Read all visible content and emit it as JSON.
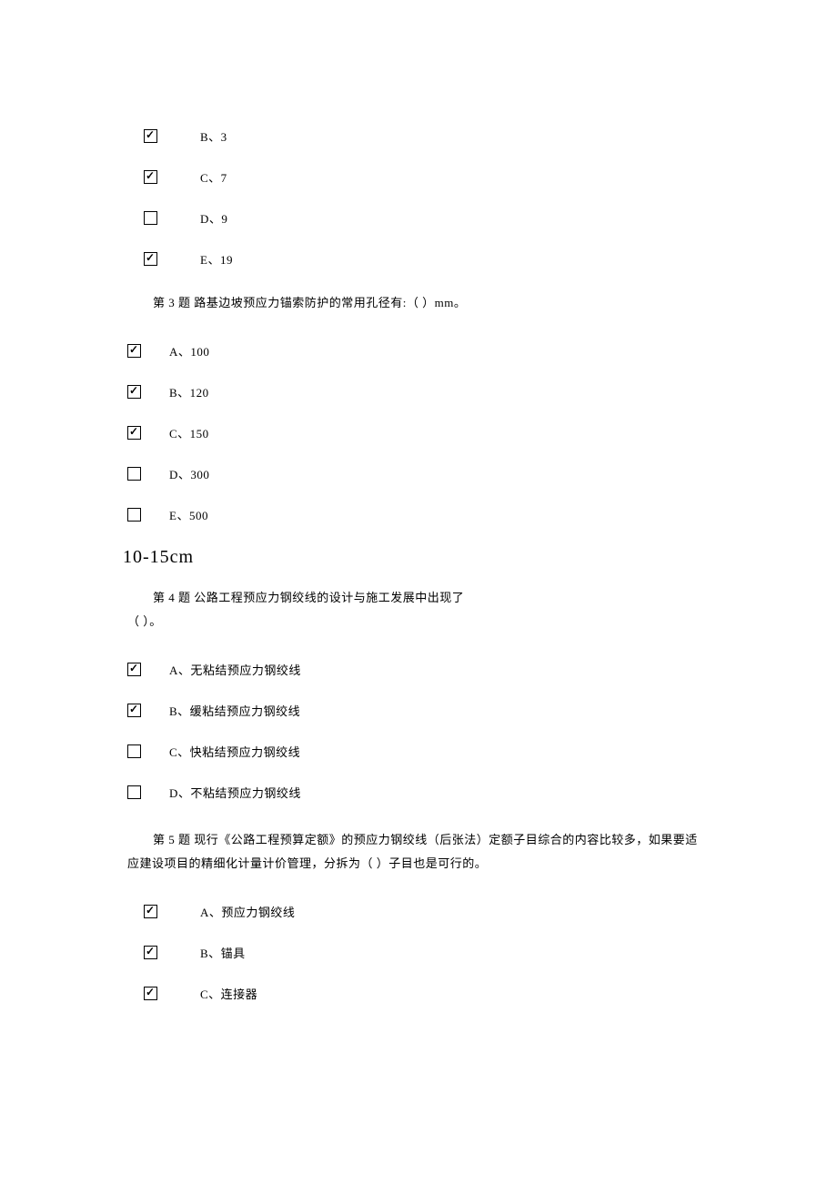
{
  "q2_options": [
    {
      "checked": true,
      "label": "B、3"
    },
    {
      "checked": true,
      "label": "C、7"
    },
    {
      "checked": false,
      "label": "D、9"
    },
    {
      "checked": true,
      "label": "E、19"
    }
  ],
  "q3": {
    "text": "第 3 题 路基边坡预应力锚索防护的常用孔径有:（ ）mm。",
    "options": [
      {
        "checked": true,
        "label": "A、100"
      },
      {
        "checked": true,
        "label": "B、120"
      },
      {
        "checked": true,
        "label": "C、150"
      },
      {
        "checked": false,
        "label": "D、300"
      },
      {
        "checked": false,
        "label": "E、500"
      }
    ],
    "note": "10-15cm"
  },
  "q4": {
    "line1": "第 4 题 公路工程预应力钢绞线的设计与施工发展中出现了",
    "line2": "（ ）。",
    "options": [
      {
        "checked": true,
        "label": "A、无粘结预应力钢绞线"
      },
      {
        "checked": true,
        "label": "B、缓粘结预应力钢绞线"
      },
      {
        "checked": false,
        "label": "C、快粘结预应力钢绞线"
      },
      {
        "checked": false,
        "label": "D、不粘结预应力钢绞线"
      }
    ]
  },
  "q5": {
    "text": "第 5 题 现行《公路工程预算定额》的预应力钢绞线（后张法）定额子目综合的内容比较多，如果要适应建设项目的精细化计量计价管理，分拆为（ ）子目也是可行的。",
    "options": [
      {
        "checked": true,
        "label": "A、预应力钢绞线"
      },
      {
        "checked": true,
        "label": "B、锚具"
      },
      {
        "checked": true,
        "label": "C、连接器"
      }
    ]
  }
}
